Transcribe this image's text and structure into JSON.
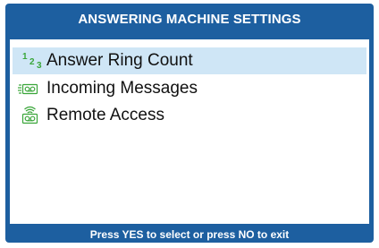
{
  "header": {
    "title": "ANSWERING MACHINE SETTINGS"
  },
  "menu": {
    "items": [
      {
        "label": "Answer Ring Count",
        "icon": "ring-count-icon",
        "selected": true
      },
      {
        "label": "Incoming Messages",
        "icon": "incoming-messages-icon",
        "selected": false
      },
      {
        "label": "Remote Access",
        "icon": "remote-access-icon",
        "selected": false
      }
    ],
    "ring_count_glyphs": [
      "1",
      "2",
      "3"
    ]
  },
  "footer": {
    "instruction": "Press YES to select or press NO to exit"
  },
  "colors": {
    "frame": "#1d5fa0",
    "selection": "#cfe6f6",
    "icon": "#3aa63a"
  }
}
